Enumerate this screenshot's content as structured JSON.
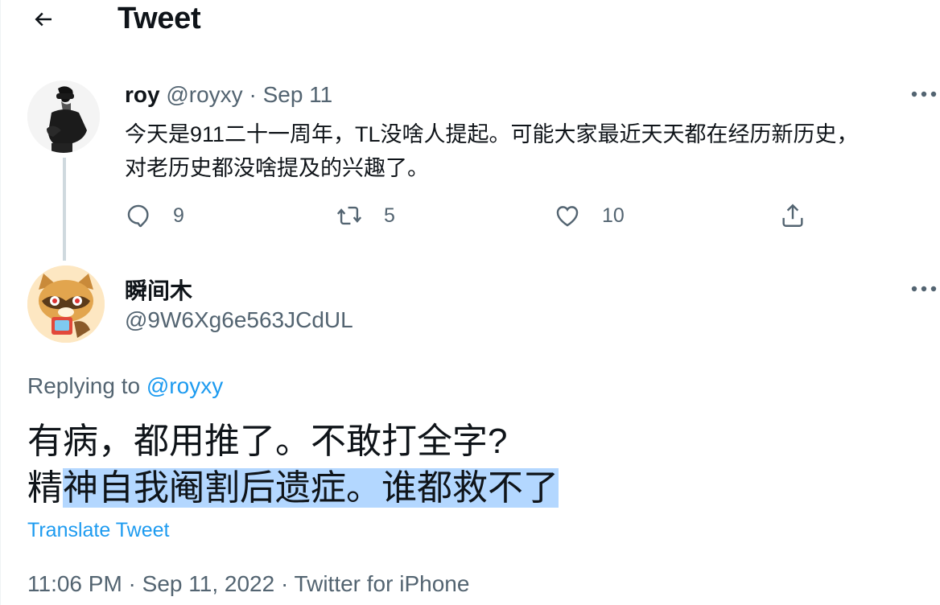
{
  "header": {
    "title": "Tweet",
    "back_icon": "arrow-left-icon"
  },
  "parent_tweet": {
    "display_name": "roy",
    "handle": "@royxy",
    "separator": " · ",
    "date": "Sep 11",
    "text_line1": "今天是911二十一周年，TL没啥人提起。可能大家最近天天都在经历新历史，",
    "text_line2": "对老历史都没啥提及的兴趣了。",
    "actions": {
      "replies": "9",
      "retweets": "5",
      "likes": "10"
    }
  },
  "main_tweet": {
    "display_name": "瞬间木",
    "handle": "@9W6Xg6e563JCdUL",
    "replying_prefix": "Replying to ",
    "replying_handle": "@royxy",
    "text_line1": "有病，都用推了。不敢打全字?",
    "text_line2_plain": "精",
    "text_line2_selected": "神自我阉割后遗症。谁都救不了",
    "translate_label": "Translate Tweet",
    "timestamp": "11:06 PM · Sep 11, 2022 · Twitter for iPhone"
  },
  "colors": {
    "text_primary": "#0f1419",
    "text_secondary": "#536471",
    "link": "#1d9bf0",
    "selection": "#b3d7ff",
    "thread_line": "#cfd9de"
  }
}
